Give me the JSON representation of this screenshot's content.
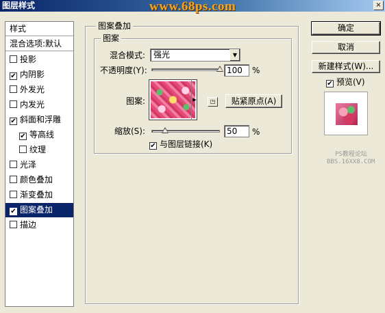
{
  "window": {
    "title": "图层样式",
    "watermark": "www.68ps.com",
    "close": "×"
  },
  "style_list": {
    "header": "样式",
    "blend_options": "混合选项:默认",
    "items": [
      {
        "label": "投影",
        "checked": false
      },
      {
        "label": "内阴影",
        "checked": true
      },
      {
        "label": "外发光",
        "checked": false
      },
      {
        "label": "内发光",
        "checked": false
      },
      {
        "label": "斜面和浮雕",
        "checked": true
      },
      {
        "label": "等高线",
        "checked": true,
        "sub": true
      },
      {
        "label": "纹理",
        "checked": false,
        "sub": true
      },
      {
        "label": "光泽",
        "checked": false
      },
      {
        "label": "颜色叠加",
        "checked": false
      },
      {
        "label": "渐变叠加",
        "checked": false
      },
      {
        "label": "图案叠加",
        "checked": true,
        "selected": true
      },
      {
        "label": "描边",
        "checked": false
      }
    ]
  },
  "panel": {
    "title": "图案叠加",
    "group": "图案",
    "blend_mode_label": "混合模式:",
    "blend_mode_value": "强光",
    "opacity_label": "不透明度(Y):",
    "opacity_value": "100",
    "opacity_unit": "%",
    "opacity_level": 1.0,
    "pattern_label": "图案:",
    "snap_origin_button": "贴紧原点(A)",
    "scale_label": "缩放(S):",
    "scale_value": "50",
    "scale_unit": "%",
    "scale_level": 0.05,
    "link_label": "与图层链接(K)",
    "link_checked": true
  },
  "buttons": {
    "ok": "确定",
    "cancel": "取消",
    "new_style": "新建样式(W)...",
    "preview_label": "预览(V)",
    "preview_checked": true
  },
  "sitemark": {
    "line1": "PS教程论坛",
    "line2": "BBS.16XX8.COM"
  }
}
